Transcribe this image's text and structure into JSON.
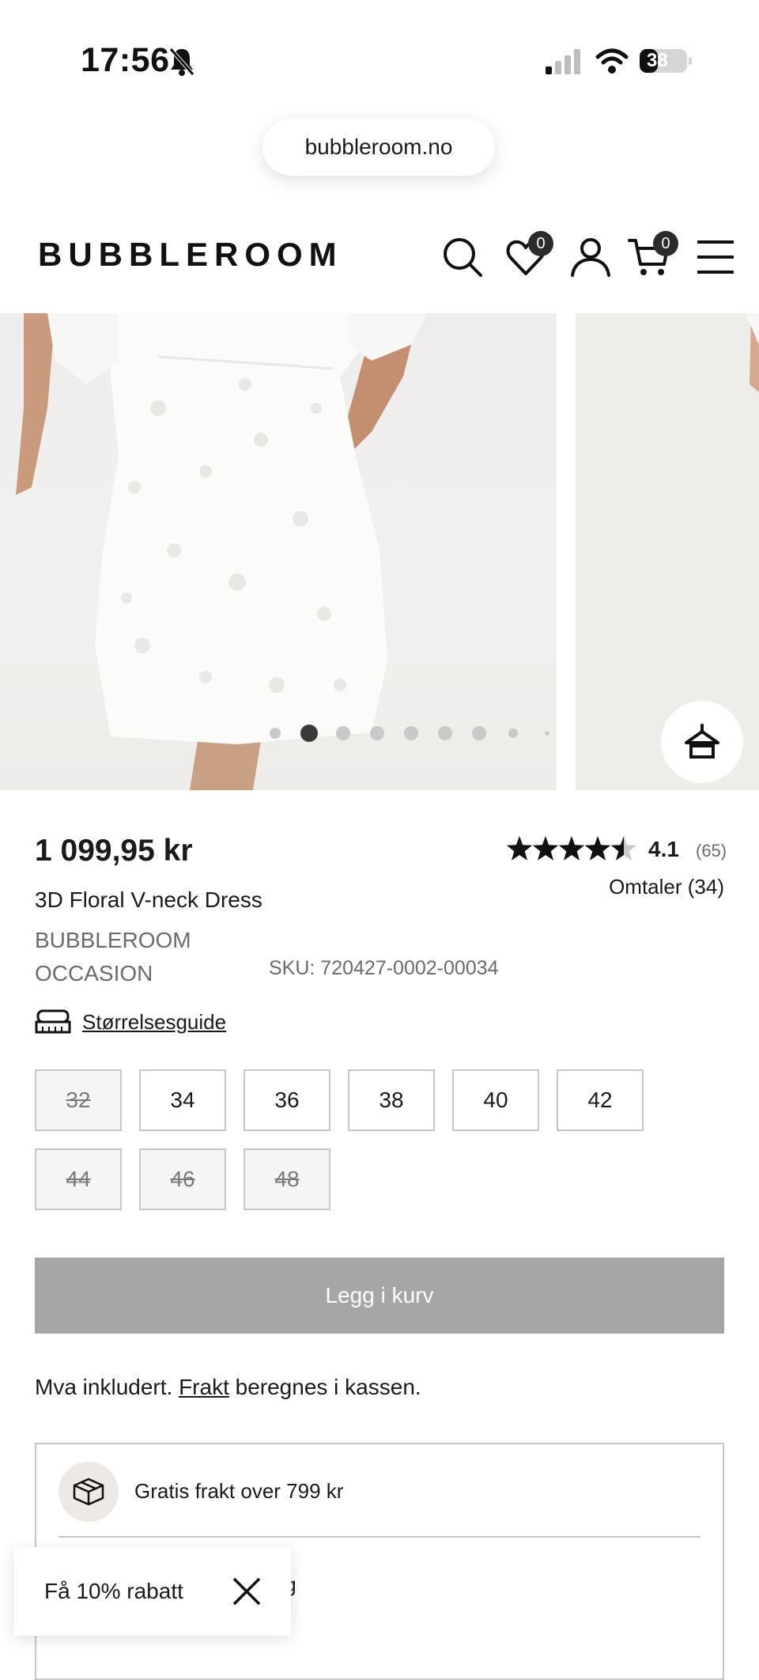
{
  "status_bar": {
    "time": "17:56",
    "battery": "38"
  },
  "browser": {
    "url": "bubbleroom.no"
  },
  "header": {
    "logo": "BUBBLEROOM",
    "wishlist_count": "0",
    "cart_count": "0"
  },
  "gallery": {
    "total_dots": 9,
    "active_index": 1
  },
  "product": {
    "price": "1 099,95 kr",
    "name": "3D Floral V-neck Dress",
    "brand": "BUBBLEROOM OCCASION",
    "sku": "SKU: 720427-0002-00034",
    "rating_value": "4.1",
    "rating_count": "(65)",
    "rating_stars": 4.1,
    "reviews_label": "Omtaler (34)",
    "size_guide_label": "Størrelsesguide"
  },
  "sizes": [
    {
      "label": "32",
      "available": false
    },
    {
      "label": "34",
      "available": true
    },
    {
      "label": "36",
      "available": true
    },
    {
      "label": "38",
      "available": true
    },
    {
      "label": "40",
      "available": true
    },
    {
      "label": "42",
      "available": true
    },
    {
      "label": "44",
      "available": false
    },
    {
      "label": "46",
      "available": false
    },
    {
      "label": "48",
      "available": false
    }
  ],
  "actions": {
    "add_to_cart": "Legg i kurv"
  },
  "vat": {
    "prefix": "Mva inkludert.",
    "link": "Frakt",
    "suffix": "beregnes i kassen."
  },
  "info": {
    "free_shipping": "Gratis frakt over 799 kr",
    "second_partial": "ing"
  },
  "promo": {
    "label": "Få 10% rabatt"
  },
  "colors": {
    "accent": "#2b2b2b",
    "disabled_button": "#a6a6a6",
    "icon_circle": "#efe9e5"
  }
}
